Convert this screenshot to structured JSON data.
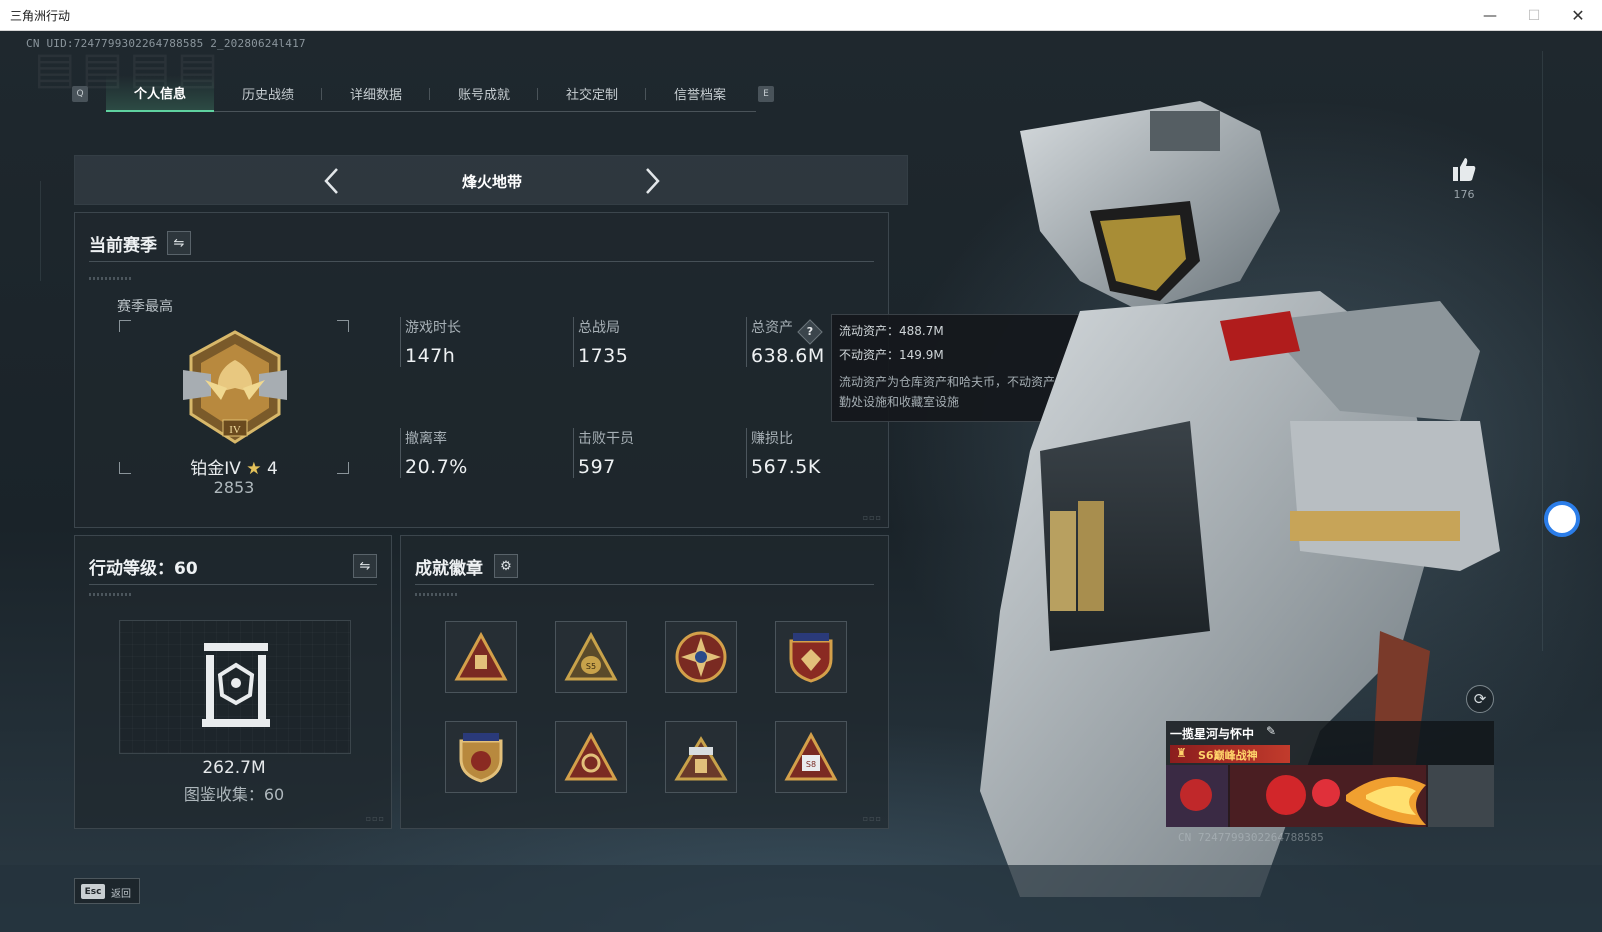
{
  "window": {
    "title": "三角洲行动",
    "min": "—",
    "max": "☐",
    "close": "✕"
  },
  "uid_text": "CN UID:7247799302264788585 2_20280624l417",
  "tabs": {
    "left_key": "Q",
    "right_key": "E",
    "items": [
      {
        "label": "个人信息",
        "active": true
      },
      {
        "label": "历史战绩",
        "active": false
      },
      {
        "label": "详细数据",
        "active": false
      },
      {
        "label": "账号成就",
        "active": false
      },
      {
        "label": "社交定制",
        "active": false
      },
      {
        "label": "信誉档案",
        "active": false
      }
    ]
  },
  "mode": {
    "title": "烽火地带",
    "prev": "‹",
    "next": "›"
  },
  "season": {
    "heading": "当前赛季",
    "switch_icon": "⇋",
    "best_label": "赛季最高",
    "rank_name": "铂金IV",
    "rank_stars": "4",
    "rank_score": "2853",
    "stats": [
      {
        "label": "游戏时长",
        "value": "147h"
      },
      {
        "label": "总战局",
        "value": "1735"
      },
      {
        "label": "总资产",
        "value": "638.6M",
        "help": "?"
      },
      {
        "label": "撤离率",
        "value": "20.7%"
      },
      {
        "label": "击败干员",
        "value": "597"
      },
      {
        "label": "赚损比",
        "value": "567.5K"
      }
    ]
  },
  "tooltip": {
    "liquid": "流动资产：488.7M",
    "fixed": "不动资产：149.9M",
    "desc": "流动资产为仓库资产和哈夫币，不动资产为特勤处设施和收藏室设施"
  },
  "level": {
    "heading": "行动等级：60",
    "switch_icon": "⇋",
    "value": "262.7M",
    "collection": "图鉴收集：60"
  },
  "badges": {
    "heading": "成就徽章",
    "gear_icon": "⚙",
    "items": [
      {
        "name": "badge-warning-box",
        "color": "#c0392b"
      },
      {
        "name": "badge-gold-bag",
        "color": "#b58a3a"
      },
      {
        "name": "badge-star-compass",
        "color": "#c0392b"
      },
      {
        "name": "badge-shield-gem",
        "color": "#c0392b"
      },
      {
        "name": "badge-shield-stars",
        "color": "#b58a3a"
      },
      {
        "name": "badge-eye-triangle",
        "color": "#c0392b"
      },
      {
        "name": "badge-crown-triangle",
        "color": "#b58a3a"
      },
      {
        "name": "badge-s8-triangle",
        "color": "#c0392b"
      }
    ]
  },
  "profile": {
    "likes": "176",
    "refresh_icon": "⟳",
    "card_name": "一揽星河与怀中",
    "card_title": "S6巅峰战神",
    "card_uid": "CN 7247799302264788585"
  },
  "footer": {
    "esc_key": "Esc",
    "back_label": "返回"
  },
  "colors": {
    "accent": "#5fd2a0",
    "panel": "#20282e",
    "gold": "#c8a24a"
  }
}
